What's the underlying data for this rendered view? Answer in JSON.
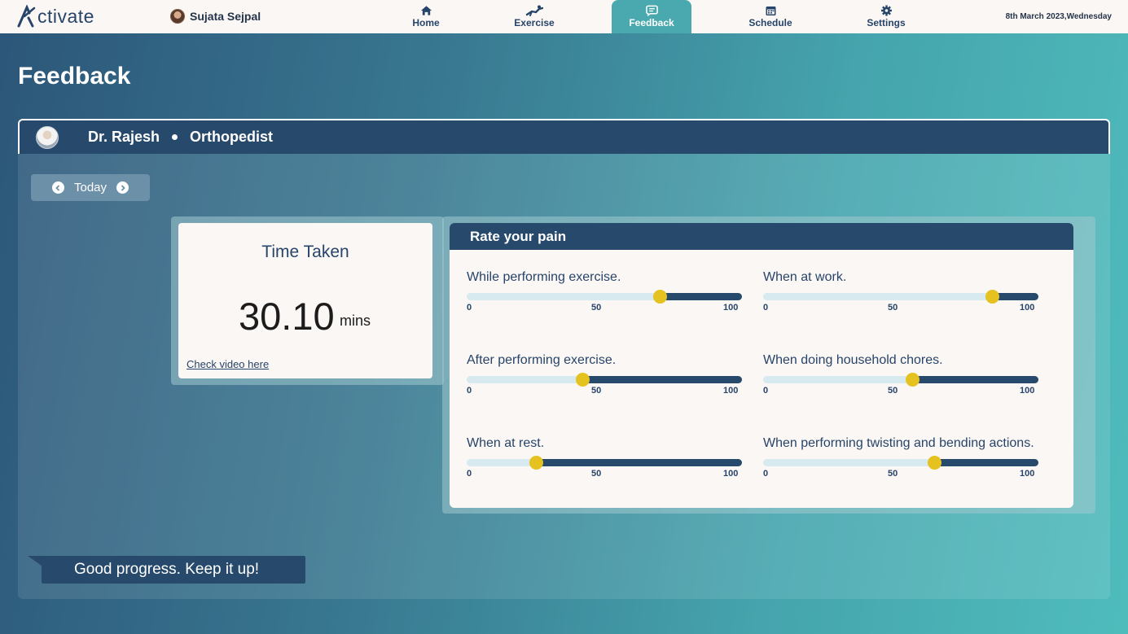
{
  "app": {
    "logo_text": "ctivate",
    "logo_letter": "A"
  },
  "user": {
    "name": "Sujata Sejpal"
  },
  "nav": {
    "items": [
      {
        "label": "Home",
        "icon": "home-icon"
      },
      {
        "label": "Exercise",
        "icon": "exercise-icon"
      },
      {
        "label": "Feedback",
        "icon": "feedback-icon",
        "active": true
      },
      {
        "label": "Schedule",
        "icon": "calendar-icon"
      },
      {
        "label": "Settings",
        "icon": "gear-icon"
      }
    ]
  },
  "date": "8th March 2023,Wednesday",
  "page": {
    "title": "Feedback"
  },
  "doctor": {
    "name": "Dr. Rajesh",
    "role": "Orthopedist"
  },
  "day_nav": {
    "label": "Today"
  },
  "time_taken": {
    "title": "Time Taken",
    "value": "30.10",
    "unit": "mins",
    "video_link": "Check video here"
  },
  "pain": {
    "title": "Rate your pain",
    "tick_labels": [
      "0",
      "50",
      "100"
    ],
    "sliders": [
      {
        "label": "While performing exercise.",
        "value": 70
      },
      {
        "label": "When at work.",
        "value": 83
      },
      {
        "label": "After performing exercise.",
        "value": 42
      },
      {
        "label": "When doing household chores.",
        "value": 54
      },
      {
        "label": "When at rest.",
        "value": 25
      },
      {
        "label": "When performing twisting and bending actions.",
        "value": 62
      }
    ]
  },
  "message": "Good progress. Keep it up!",
  "colors": {
    "navy": "#27496b",
    "teal": "#4aa9ae",
    "thumb": "#e5c21f",
    "cream": "#fbf7f4"
  }
}
